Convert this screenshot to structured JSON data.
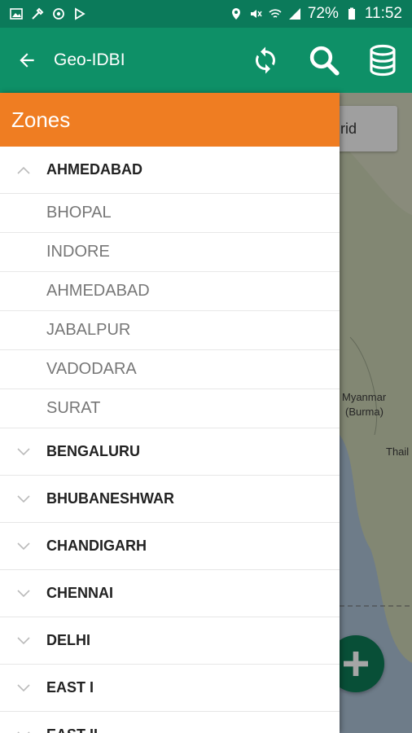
{
  "status_bar": {
    "battery": "72%",
    "time": "11:52"
  },
  "app_bar": {
    "title": "Geo-IDBI",
    "icons": [
      "back-arrow-icon",
      "sync-icon",
      "search-icon",
      "database-icon"
    ]
  },
  "map": {
    "button_label": "rid",
    "labels": [
      "Myanmar",
      "(Burma)",
      "Thail"
    ]
  },
  "drawer": {
    "header": "Zones",
    "expanded_group": {
      "label": "AHMEDABAD",
      "children": [
        "BHOPAL",
        "INDORE",
        "AHMEDABAD",
        "JABALPUR",
        "VADODARA",
        "SURAT"
      ]
    },
    "groups": [
      "BENGALURU",
      "BHUBANESHWAR",
      "CHANDIGARH",
      "CHENNAI",
      "DELHI",
      "EAST I",
      "EAST II"
    ]
  },
  "colors": {
    "status_bar": "#0b7a5a",
    "app_bar": "#0e9067",
    "drawer_header": "#ef7d22"
  }
}
